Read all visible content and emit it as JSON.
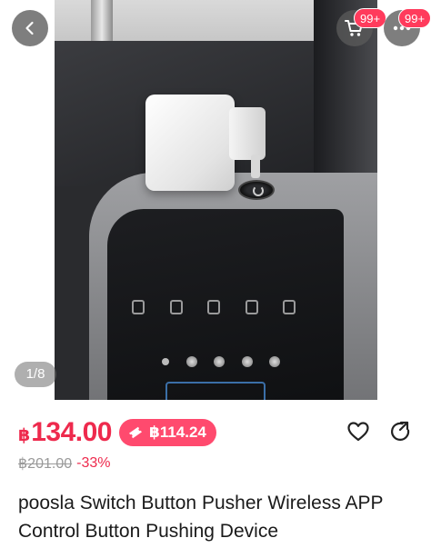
{
  "gallery": {
    "page_indicator": "1/8",
    "cart_badge": "99+",
    "more_badge": "99+"
  },
  "icons": {
    "back": "chevron-left-icon",
    "cart": "cart-icon",
    "more": "more-dots-icon",
    "wishlist": "heart-icon",
    "share": "share-icon",
    "coupon": "ticket-icon"
  },
  "price": {
    "currency_symbol": "฿",
    "amount": "134.00",
    "coupon_price": "฿114.24",
    "original_price": "฿201.00",
    "discount": "-33%"
  },
  "product": {
    "title": "poosla Switch Button Pusher Wireless APP Control Button Pushing Device"
  },
  "colors": {
    "accent": "#ee2a4d",
    "coupon_bg": "#ff4a6e",
    "badge": "#ff3b5c"
  }
}
